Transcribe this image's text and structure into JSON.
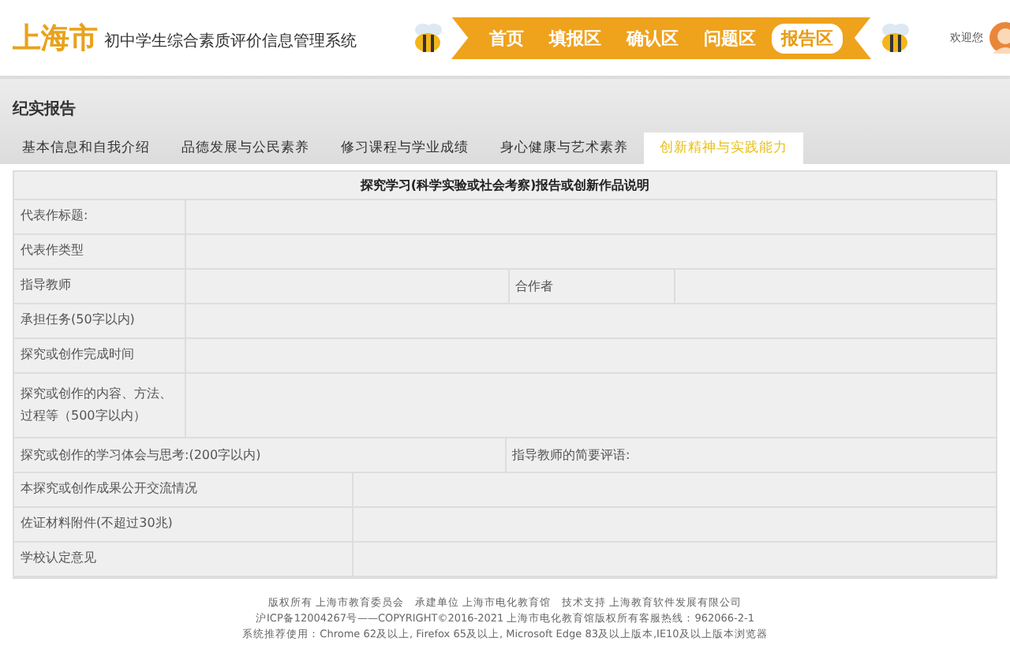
{
  "header": {
    "city": "上海市",
    "system_title": "初中学生综合素质评价信息管理系统",
    "welcome": "欢迎您"
  },
  "nav": [
    {
      "label": "首页",
      "selected": false
    },
    {
      "label": "填报区",
      "selected": false
    },
    {
      "label": "确认区",
      "selected": false
    },
    {
      "label": "问题区",
      "selected": false
    },
    {
      "label": "报告区",
      "selected": true
    }
  ],
  "section_title": "纪实报告",
  "tabs": [
    {
      "label": "基本信息和自我介绍",
      "selected": false
    },
    {
      "label": "品德发展与公民素养",
      "selected": false
    },
    {
      "label": "修习课程与学业成绩",
      "selected": false
    },
    {
      "label": "身心健康与艺术素养",
      "selected": false
    },
    {
      "label": "创新精神与实践能力",
      "selected": true
    }
  ],
  "table": {
    "title": "探究学习(科学实验或社会考察)报告或创新作品说明",
    "rows": [
      {
        "kind": "field",
        "label": "代表作标题:"
      },
      {
        "kind": "field",
        "label": "代表作类型"
      },
      {
        "kind": "pair",
        "label": "指导教师",
        "label_2": "合作者"
      },
      {
        "kind": "field",
        "label": "承担任务(50字以内)"
      },
      {
        "kind": "field",
        "label": "探究或创作完成时间"
      },
      {
        "kind": "tall",
        "label": "探究或创作的内容、方法、过程等（500字以内）"
      },
      {
        "kind": "notes",
        "label": "探究或创作的学习体会与思考:(200字以内)",
        "label_2": "指导教师的简要评语:"
      },
      {
        "kind": "wide",
        "label": "本探究或创作成果公开交流情况"
      },
      {
        "kind": "wide",
        "label": "佐证材料附件(不超过30兆)"
      },
      {
        "kind": "wide",
        "label": "学校认定意见"
      }
    ]
  },
  "footer": [
    "版权所有 上海市教育委员会　承建单位 上海市电化教育馆　技术支持 上海教育软件发展有限公司",
    "沪ICP备12004267号——COPYRIGHT©2016-2021 上海市电化教育馆版权所有客服热线：962066-2-1",
    "系统推荐使用：Chrome 62及以上, Firefox 65及以上, Microsoft Edge 83及以上版本,IE10及以上版本浏览器"
  ]
}
